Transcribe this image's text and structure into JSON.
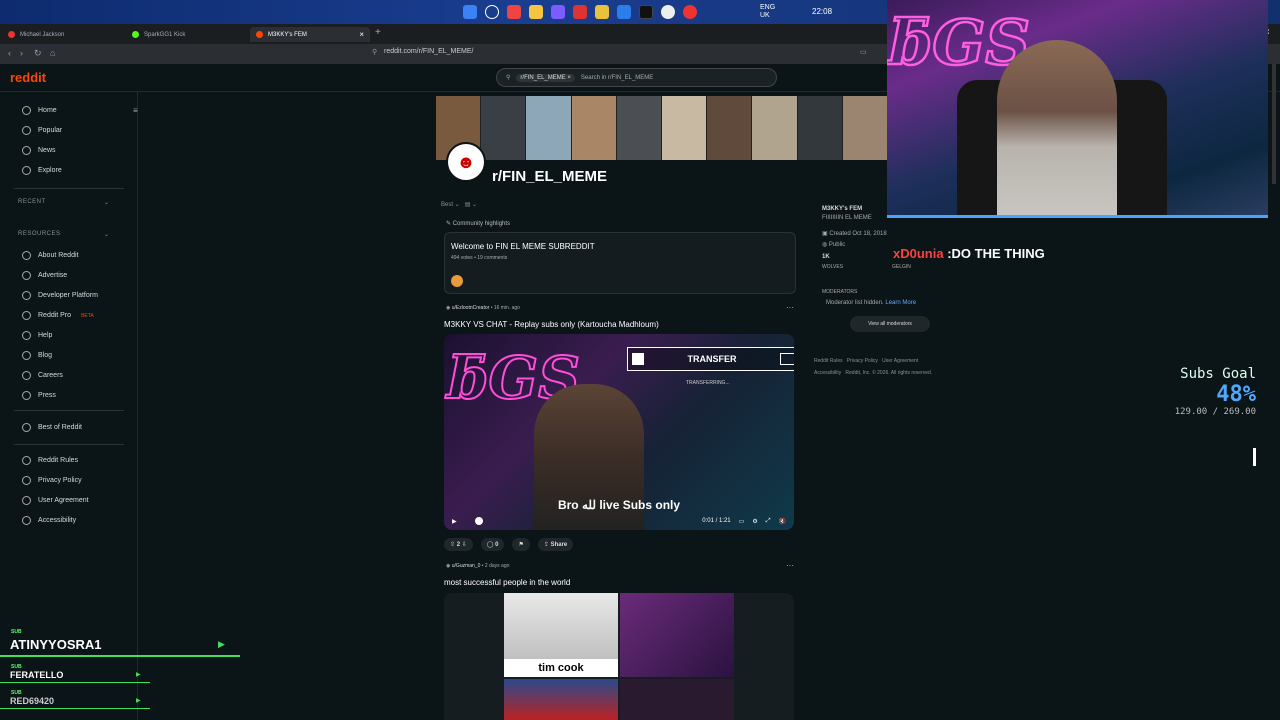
{
  "taskbar": {
    "lang_top": "ENG",
    "lang_bottom": "UK",
    "time": "22:08"
  },
  "tabs": [
    {
      "label": "Michael Jackson",
      "color": "#e33"
    },
    {
      "label": "SparkGG1 Kick",
      "color": "#53fc18"
    },
    {
      "label": "M3KKY's FEM",
      "color": "#ff4500"
    }
  ],
  "address": {
    "url": "reddit.com/r/FIN_EL_MEME/"
  },
  "header": {
    "logo": "reddit",
    "search_chip": "r/FIN_EL_MEME",
    "search_placeholder": "Search in r/FIN_EL_MEME"
  },
  "sidebar": {
    "top": [
      "Home",
      "Popular",
      "News",
      "Explore"
    ],
    "recent_label": "RECENT",
    "resources_label": "RESOURCES",
    "resources": [
      "About Reddit",
      "Advertise",
      "Developer Platform",
      "Reddit Pro",
      "Help",
      "Blog",
      "Careers",
      "Press"
    ],
    "beta": "BETA",
    "best_of": "Best of Reddit",
    "legal": [
      "Reddit Rules",
      "Privacy Policy",
      "User Agreement",
      "Accessibility"
    ]
  },
  "subreddit": {
    "name": "r/FIN_EL_MEME",
    "sort": "Best"
  },
  "highlights": {
    "label": "Community highlights",
    "title": "Welcome to FIN EL MEME SUBREDDIT",
    "meta": "494 votes • 19 comments"
  },
  "post1": {
    "author": "u/EzlootnCreator",
    "time": "• 16 min. ago",
    "title": "M3KKY VS CHAT - Replay subs only (Kartoucha Madhloum)",
    "overlay_text": "TRANSFER",
    "overlay_sub": "TRANSFERRING...",
    "caption": "Bro لله live Subs only",
    "timecode": "0:01 / 1:21",
    "votes": "2",
    "comments": "0",
    "share": "Share"
  },
  "post2": {
    "author": "u/Guzman_0",
    "time": "• 2 days ago",
    "title": "most successful people in the world",
    "meme_label": "tim cook"
  },
  "rpanel": {
    "title": "M3KKY's FEM",
    "desc": "FIIIIIIIIN EL MEME",
    "created": "Created Oct 18, 2018",
    "public": "Public",
    "members": "1K",
    "members_label": "WOLVES",
    "online_label": "GELGIN",
    "mods_label": "MODERATORS",
    "mods_hidden": "Moderator list hidden.",
    "learn_more": "Learn More",
    "view_mods": "View all moderators",
    "footer1": "Reddit Rules   Privacy Policy   User Agreement",
    "footer2": "Accessibility   Reddit, Inc. © 2026. All rights reserved."
  },
  "stream": {
    "chat_name": "xD0unia",
    "chat_text": ":DO THE THING",
    "goal_title": "Subs Goal",
    "goal_percent": "48%",
    "goal_percent_value": 48,
    "goal_values": "129.00 / 269.00",
    "subs": [
      {
        "label": "SUB",
        "name": "ATINYYOSRA1"
      },
      {
        "label": "SUB",
        "name": "FERATELLO"
      },
      {
        "label": "SUB",
        "name": "RED69420"
      }
    ]
  },
  "colors": {
    "brand": "#ff4500",
    "bg": "#0b1416",
    "neon": "#ff4fd8",
    "goal": "#4fa8ff"
  }
}
